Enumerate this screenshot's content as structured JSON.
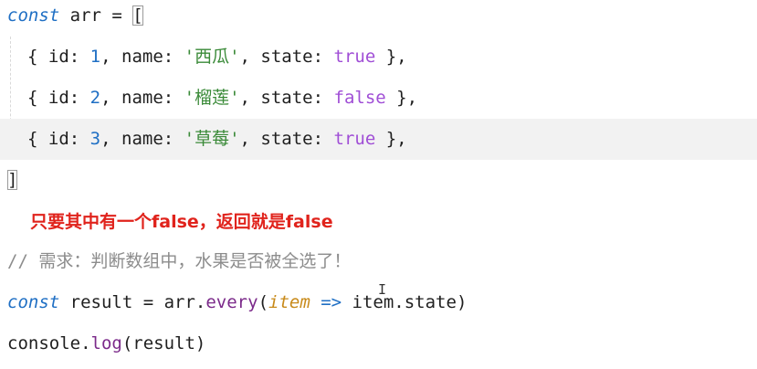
{
  "editor": {
    "line1": {
      "kw": "const",
      "rest": " arr = ",
      "bracket": "["
    },
    "items": [
      {
        "open": "{ ",
        "id_key": "id: ",
        "id_val": "1",
        "sep1": ", ",
        "name_key": "name: ",
        "name_val": "'西瓜'",
        "sep2": ", ",
        "state_key": "state: ",
        "state_val": "true",
        "close": " },"
      },
      {
        "open": "{ ",
        "id_key": "id: ",
        "id_val": "2",
        "sep1": ", ",
        "name_key": "name: ",
        "name_val": "'榴莲'",
        "sep2": ", ",
        "state_key": "state: ",
        "state_val": "false",
        "close": " },"
      },
      {
        "open": "{ ",
        "id_key": "id: ",
        "id_val": "3",
        "sep1": ", ",
        "name_key": "name: ",
        "name_val": "'草莓'",
        "sep2": ", ",
        "state_key": "state: ",
        "state_val": "true",
        "close": " },"
      }
    ],
    "line_close": "]",
    "note": "只要其中有一个false，返回就是false",
    "comment": "// 需求：判断数组中，水果是否被全选了！",
    "result_line": {
      "kw": "const",
      "a": " result = arr.",
      "fn": "every",
      "paren_open": "(",
      "param": "item",
      "arrow": " =>",
      "b": " item.state)"
    },
    "log_line": {
      "a": "console.",
      "fn": "log",
      "b": "(result)"
    },
    "cursor_glyph": "I"
  }
}
